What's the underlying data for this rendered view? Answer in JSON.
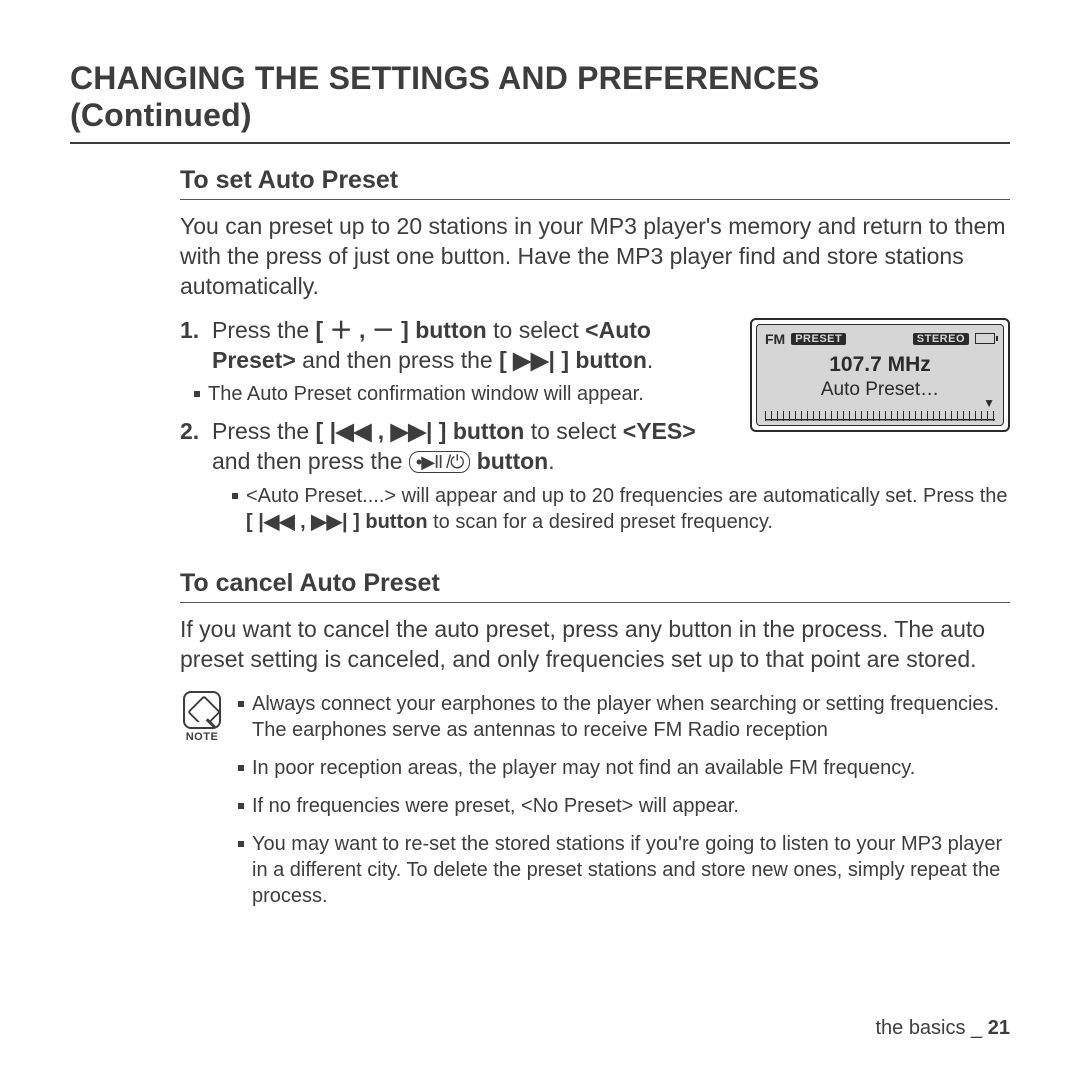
{
  "title": "CHANGING THE SETTINGS AND PREFERENCES (Continued)",
  "section1": {
    "heading": "To set Auto Preset",
    "intro": "You can preset up to 20 stations in your MP3 player's memory and return to them with the press of just one button. Have the MP3 player find and store stations automatically.",
    "step1_a": "Press the ",
    "step1_b": "[ ＋ , － ] button",
    "step1_c": " to select ",
    "step1_d": "<Auto Preset>",
    "step1_e": " and then press the ",
    "step1_f": "[ ▶▶| ] button",
    "step1_g": ".",
    "step1_sub": "The Auto Preset confirmation window will appear.",
    "step2_a": "Press the ",
    "step2_b": "[ |◀◀ , ▶▶| ] button",
    "step2_c": " to select ",
    "step2_d": "<YES>",
    "step2_e": " and then press the ",
    "step2_f": " button",
    "step2_g": ".",
    "step2_sub_a": "<Auto Preset....> will appear and up to 20 frequencies are automatically set. Press the ",
    "step2_sub_b": "[ |◀◀ , ▶▶| ] button",
    "step2_sub_c": " to scan for a desired preset frequency."
  },
  "screen": {
    "fm": "FM",
    "preset": "PRESET",
    "stereo": "STEREO",
    "freq": "107.7 MHz",
    "label": "Auto Preset…"
  },
  "section2": {
    "heading": "To cancel Auto Preset",
    "body": "If you want to cancel the auto preset, press any button in the process. The auto preset setting is canceled, and only frequencies set up to that point are stored."
  },
  "notes": {
    "label": "NOTE",
    "items": [
      "Always connect your earphones to the player when searching or setting frequencies. The earphones serve as antennas to receive FM Radio reception",
      "In poor reception areas, the player may not find an available FM frequency.",
      "If no frequencies were preset, <No Preset> will appear.",
      "You may want to re-set the stored stations if you're going to listen to your MP3 player in a different city. To delete the preset stations and store new ones, simply repeat the process."
    ]
  },
  "footer": {
    "section": "the basics _ ",
    "page": "21"
  },
  "pill_glyphs": "•▶II /⏻"
}
